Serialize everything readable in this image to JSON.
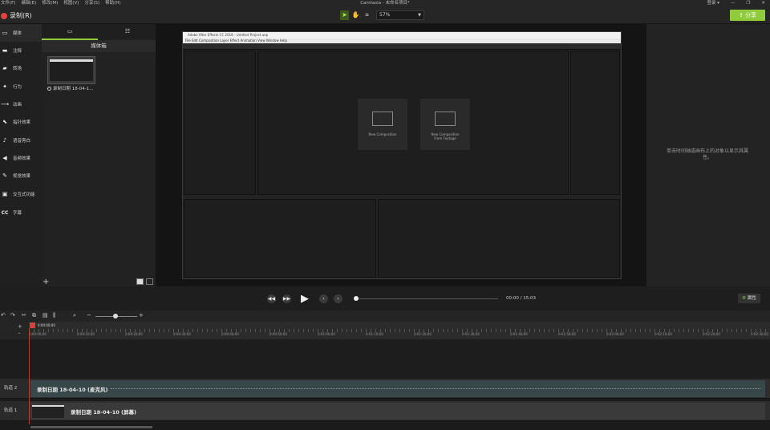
{
  "titlebar": {
    "menus": [
      "文件(F)",
      "编辑(E)",
      "修改(M)",
      "视图(V)",
      "分享(S)",
      "帮助(H)"
    ],
    "title": "Camtasia - 未命名项目*",
    "user": "登录 ▾"
  },
  "toolbar": {
    "record_label": "录制(R)",
    "zoom_value": "57%",
    "share_label": "⇪ 分享"
  },
  "sidebar": {
    "items": [
      {
        "icon": "media-icon",
        "glyph": "▭",
        "label": "媒体"
      },
      {
        "icon": "annotation-icon",
        "glyph": "▬",
        "label": "注释"
      },
      {
        "icon": "transition-icon",
        "glyph": "▰",
        "label": "转场"
      },
      {
        "icon": "behavior-icon",
        "glyph": "✦",
        "label": "行为"
      },
      {
        "icon": "animation-icon",
        "glyph": "⟶",
        "label": "动画"
      },
      {
        "icon": "cursor-effect-icon",
        "glyph": "⬉",
        "label": "指针效果"
      },
      {
        "icon": "voice-narration-icon",
        "glyph": "🎙",
        "label": "语音旁白"
      },
      {
        "icon": "audio-effect-icon",
        "glyph": "◀",
        "label": "音频效果"
      },
      {
        "icon": "visual-effect-icon",
        "glyph": "✎",
        "label": "视觉效果"
      },
      {
        "icon": "interactive-icon",
        "glyph": "▣",
        "label": "交互式功能"
      },
      {
        "icon": "captions-icon",
        "glyph": "CC",
        "label": "字幕"
      }
    ]
  },
  "media_bin": {
    "heading": "媒体箱",
    "clip_label": "录制日期 18-04-1..."
  },
  "canvas": {
    "ae_window_title": "Adobe After Effects CC 2018 - Untitled Project.aep",
    "ae_menu": "File  Edit  Composition  Layer  Effect  Animation  View  Window  Help",
    "new_composition": "New Composition",
    "new_from_footage_1": "New Composition",
    "new_from_footage_2": "From Footage"
  },
  "properties_hint": "单击时间轴或画布上的对象以显示其属性。",
  "player": {
    "time": "00:00  /  15:03",
    "properties_button": "属性"
  },
  "timeline": {
    "playhead_time": "0:00:00;00",
    "ruler_ticks": [
      "0:00:00;00",
      "0:00:10;00",
      "0:00:20;00",
      "0:00:30;00",
      "0:00:40;00",
      "0:00:50;00",
      "0:01:00;00",
      "0:01:10;00",
      "0:01:20;00",
      "0:01:30;00",
      "0:01:40;00",
      "0:01:50;00",
      "0:02:00;00",
      "0:02:10;00",
      "0:02:20;00",
      "0:02:30;00"
    ],
    "tracks": [
      {
        "name": "轨道 2",
        "clip": "录制日期 18-04-10 (麦克风)"
      },
      {
        "name": "轨道 1",
        "clip": "录制日期 18-04-10 (屏幕)"
      }
    ]
  }
}
